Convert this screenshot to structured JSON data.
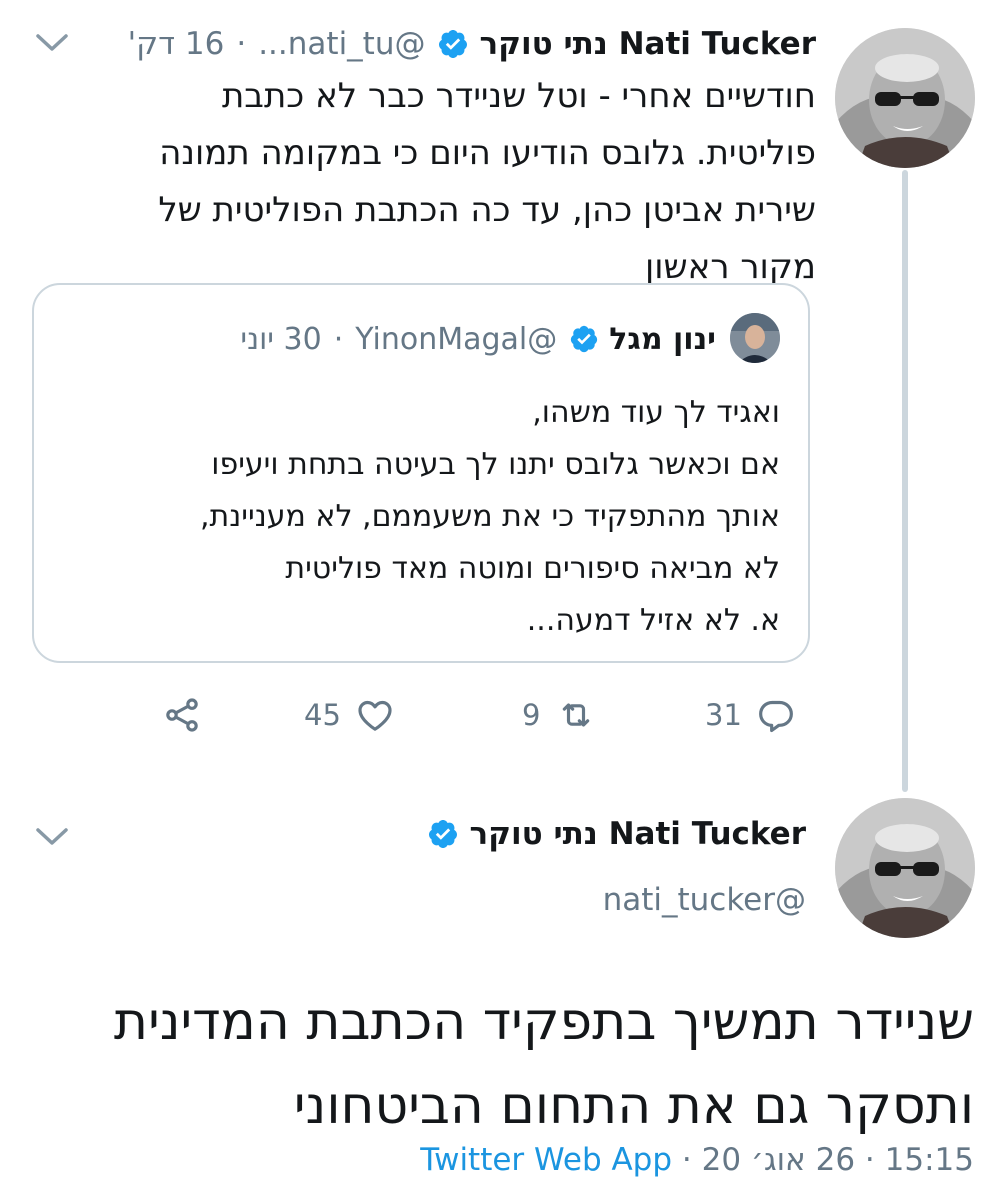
{
  "tweet1": {
    "display_name": "Nati Tucker נתי טוקר",
    "handle": "@nati_tu...",
    "time": "16 דק'",
    "text_lines": [
      "חודשיים אחרי - וטל שניידר כבר לא כתבת",
      "פוליטית. גלובס הודיעו היום כי במקומה תמונה",
      "שירית אביטן כהן, עד כה הכתבת הפוליטית של",
      "מקור ראשון"
    ],
    "quote": {
      "display_name": "ינון מגל",
      "handle": "@YinonMagal",
      "date": "30 יוני",
      "text_lines": [
        "ואגיד לך עוד משהו,",
        "אם וכאשר גלובס יתנו לך בעיטה בתחת ויעיפו",
        "אותך מהתפקיד כי את משעממם, לא מעניינת,",
        "לא מביאה סיפורים ומוטה מאד פוליטית",
        "א. לא אזיל דמעה..."
      ]
    },
    "actions": {
      "replies": "31",
      "retweets": "9",
      "likes": "45"
    }
  },
  "tweet2": {
    "display_name": "Nati Tucker נתי טוקר",
    "handle": "@nati_tucker",
    "text_lines": [
      "שניידר תמשיך בתפקיד הכתבת המדינית",
      "ותסקר גם את התחום הביטחוני"
    ],
    "time": "15:15",
    "date": "26 אוג׳ 20",
    "app": "Twitter Web App"
  },
  "colors": {
    "verified": "#1da1f2",
    "muted": "#657786",
    "link": "#1b95e0",
    "border": "#ccd6dd"
  },
  "icons": [
    "verified-badge-icon",
    "chevron-down-icon",
    "reply-icon",
    "retweet-icon",
    "like-icon",
    "share-icon"
  ]
}
